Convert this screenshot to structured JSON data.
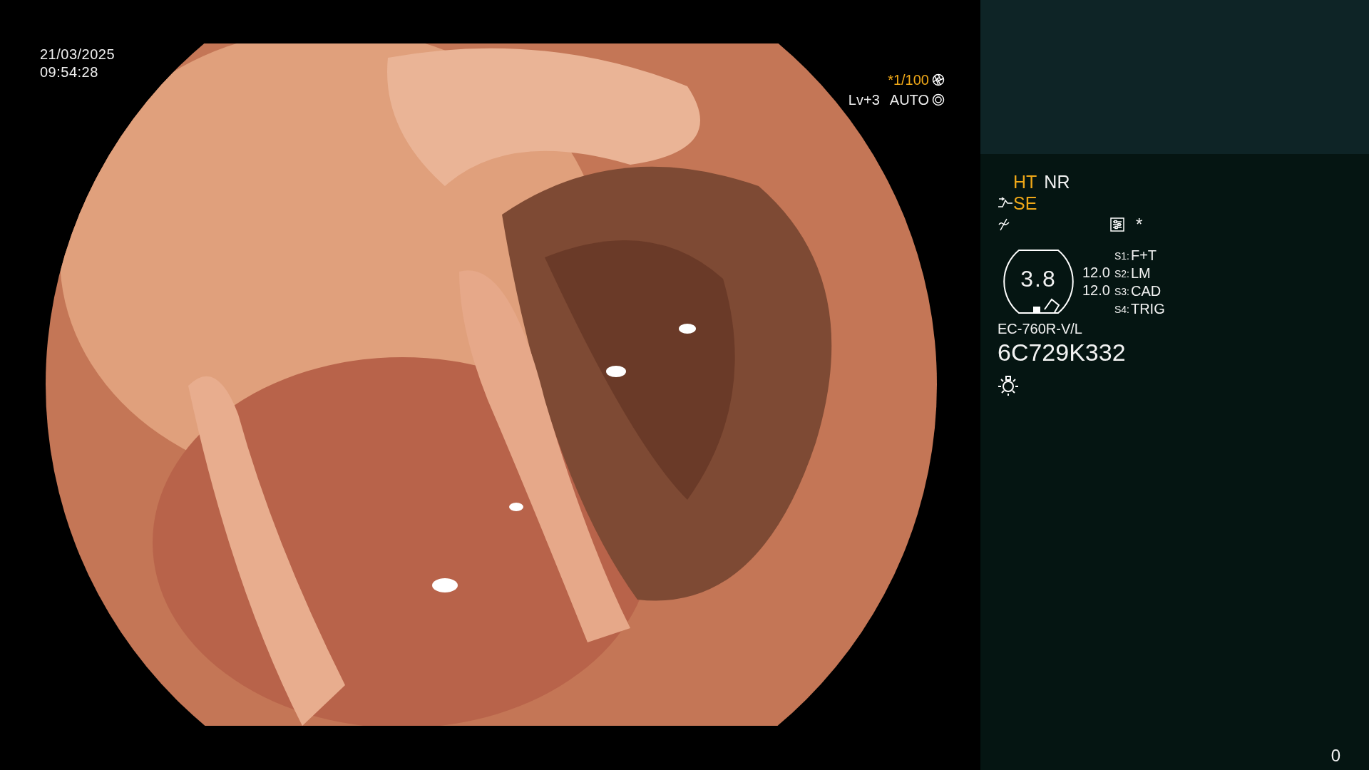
{
  "timestamp": {
    "date": "21/03/2025",
    "time": "09:54:28"
  },
  "exposure": {
    "shutter": "*1/100",
    "level": "Lv+3",
    "mode": "AUTO"
  },
  "enhancements": [
    {
      "label": "HT",
      "active": true
    },
    {
      "label": "NR",
      "active": false
    }
  ],
  "structure_enhancement": {
    "label": "SE",
    "active": true
  },
  "extra_mark": "*",
  "scope": {
    "value": "3.8",
    "readings": [
      "12.0",
      "12.0"
    ],
    "model": "EC-760R-V/L",
    "serial": "6C729K332"
  },
  "switches": [
    {
      "key": "S1:",
      "value": "F+T"
    },
    {
      "key": "S2:",
      "value": "LM"
    },
    {
      "key": "S3:",
      "value": "CAD"
    },
    {
      "key": "S4:",
      "value": "TRIG"
    }
  ],
  "counter": "0"
}
